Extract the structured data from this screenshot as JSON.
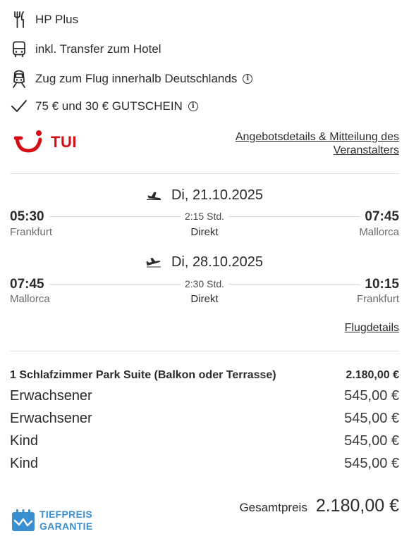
{
  "features": [
    {
      "icon": "cutlery-icon",
      "text": "HP Plus"
    },
    {
      "icon": "bus-icon",
      "text": "inkl. Transfer zum Hotel"
    },
    {
      "icon": "train-icon",
      "text": "Zug zum Flug innerhalb Deutschlands"
    },
    {
      "icon": "check-icon",
      "text": "75 € und 30 € GUTSCHEIN"
    }
  ],
  "operator": {
    "logo_text": "TUI",
    "details_link": "Angebotsdetails & Mitteilung des Veranstalters"
  },
  "flights": {
    "outbound": {
      "date": "Di, 21.10.2025",
      "departure_time": "05:30",
      "departure_city": "Frankfurt",
      "duration": "2:15 Std.",
      "stops": "Direkt",
      "arrival_time": "07:45",
      "arrival_city": "Mallorca"
    },
    "return": {
      "date": "Di, 28.10.2025",
      "departure_time": "07:45",
      "departure_city": "Mallorca",
      "duration": "2:30 Std.",
      "stops": "Direkt",
      "arrival_time": "10:15",
      "arrival_city": "Frankfurt"
    },
    "details_link": "Flugdetails"
  },
  "pricing": {
    "room": {
      "label": "1 Schlafzimmer Park Suite (Balkon oder Terrasse)",
      "amount": "2.180,00 €"
    },
    "travellers": [
      {
        "label": "Erwachsener",
        "amount": "545,00 €"
      },
      {
        "label": "Erwachsener",
        "amount": "545,00 €"
      },
      {
        "label": "Kind",
        "amount": "545,00 €"
      },
      {
        "label": "Kind",
        "amount": "545,00 €"
      }
    ],
    "total_label": "Gesamtpreis",
    "total_amount": "2.180,00 €"
  },
  "badge": {
    "line1": "TIEFPREIS",
    "line2": "GARANTIE"
  },
  "colors": {
    "brand_red": "#d40e14",
    "badge_blue": "#3a8fd0",
    "text": "#2b2b2b",
    "muted": "#6a6a6a"
  }
}
